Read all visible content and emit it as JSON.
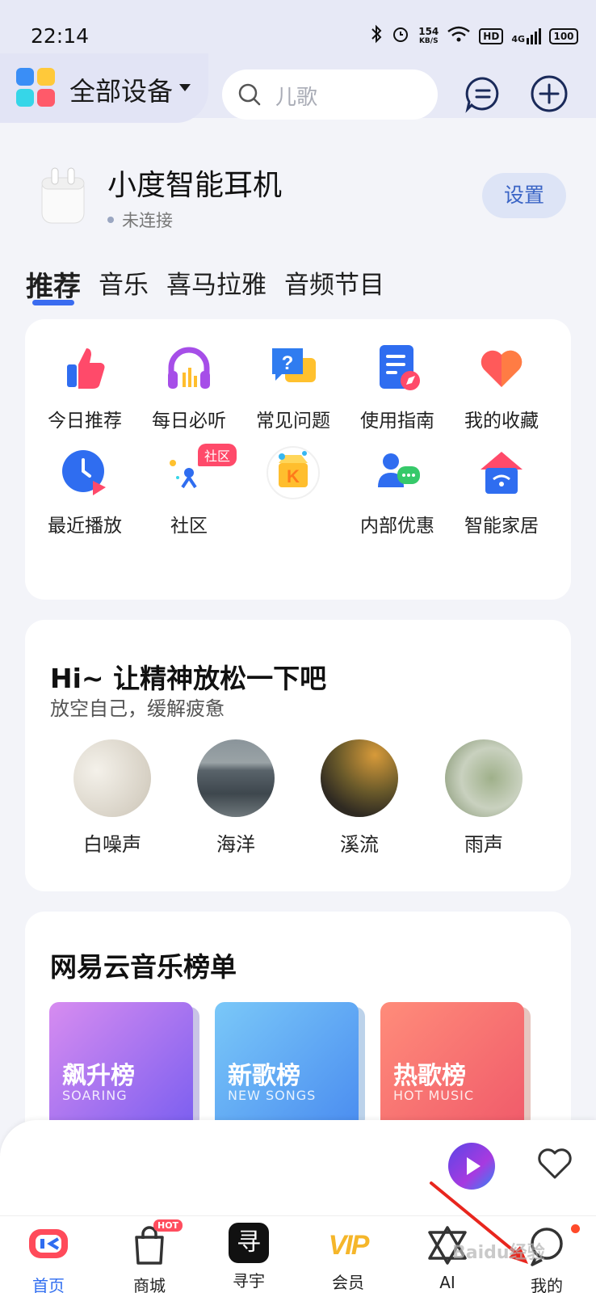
{
  "status_bar": {
    "time": "22:14",
    "net_speed_value": "154",
    "net_speed_unit": "KB/S",
    "hd": "HD",
    "signal": "4G",
    "battery": "100"
  },
  "header": {
    "device_selector": "全部设备",
    "search_placeholder": "儿歌",
    "colors": {
      "accent": "#3a6cf0"
    }
  },
  "device": {
    "name": "小度智能耳机",
    "status": "未连接",
    "settings_label": "设置"
  },
  "tabs": [
    {
      "label": "推荐",
      "active": true
    },
    {
      "label": "音乐",
      "active": false
    },
    {
      "label": "喜马拉雅",
      "active": false
    },
    {
      "label": "音频节目",
      "active": false
    }
  ],
  "shortcuts": [
    {
      "label": "今日推荐",
      "icon": "thumbs-up-icon"
    },
    {
      "label": "每日必听",
      "icon": "headphones-icon"
    },
    {
      "label": "常见问题",
      "icon": "question-bubble-icon"
    },
    {
      "label": "使用指南",
      "icon": "guide-icon"
    },
    {
      "label": "我的收藏",
      "icon": "heart-icon"
    },
    {
      "label": "最近播放",
      "icon": "recent-play-icon"
    },
    {
      "label": "社区",
      "icon": "community-icon",
      "badge": "社区"
    },
    {
      "label": "",
      "icon": "kuwo-k-icon"
    },
    {
      "label": "内部优惠",
      "icon": "chat-user-icon"
    },
    {
      "label": "智能家居",
      "icon": "smart-home-icon"
    }
  ],
  "relax": {
    "title": "Hi~ 让精神放松一下吧",
    "subtitle": "放空自己，缓解疲惫",
    "sounds": [
      {
        "label": "白噪声"
      },
      {
        "label": "海洋"
      },
      {
        "label": "溪流"
      },
      {
        "label": "雨声"
      }
    ]
  },
  "charts": {
    "title": "网易云音乐榜单",
    "items": [
      {
        "name": "飙升榜",
        "en": "SOARING"
      },
      {
        "name": "新歌榜",
        "en": "NEW SONGS"
      },
      {
        "name": "热歌榜",
        "en": "HOT MUSIC"
      }
    ]
  },
  "bottom_nav": [
    {
      "label": "首页",
      "active": true
    },
    {
      "label": "商城",
      "badge": "HOT"
    },
    {
      "label": "寻宇"
    },
    {
      "label": "会员",
      "icon_text": "VIP"
    },
    {
      "label": "AI"
    },
    {
      "label": "我的"
    }
  ],
  "shop_badge": "HOT",
  "xunyu_glyph": "寻",
  "watermark": "Baidu经验"
}
